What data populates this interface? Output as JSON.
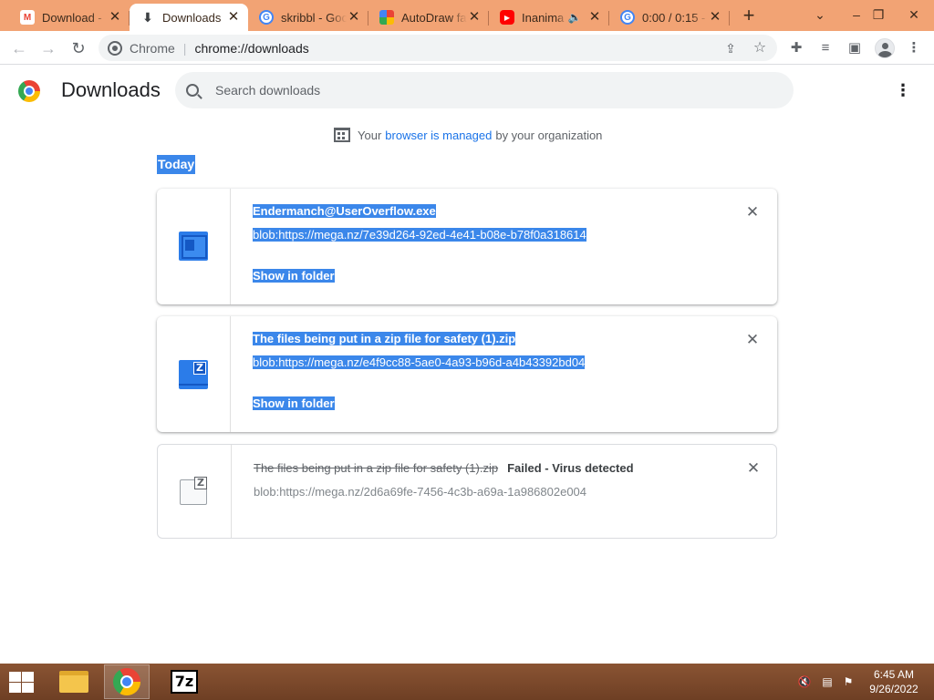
{
  "tabs": [
    {
      "title": "Download -",
      "favicon": "gmail-icon",
      "active": false
    },
    {
      "title": "Downloads",
      "favicon": "download-icon",
      "active": true
    },
    {
      "title": "skribbl - Goo",
      "favicon": "google-icon",
      "active": false
    },
    {
      "title": "AutoDraw fa",
      "favicon": "autodraw-icon",
      "active": false
    },
    {
      "title": "Inanima",
      "favicon": "youtube-icon",
      "active": false,
      "audio": true
    },
    {
      "title": "0:00 / 0:15 -",
      "favicon": "google-icon",
      "active": false
    }
  ],
  "omnibox": {
    "site_label": "Chrome",
    "url": "chrome://downloads"
  },
  "page": {
    "title": "Downloads",
    "search_placeholder": "Search downloads"
  },
  "managed_notice": {
    "prefix": "Your",
    "link": "browser is managed",
    "suffix": "by your organization"
  },
  "date_header": "Today",
  "downloads": [
    {
      "filename": "Endermanch@UserOverflow.exe",
      "url": "blob:https://mega.nz/7e39d264-92ed-4e41-b08e-b78f0a318614",
      "action": "Show in folder",
      "status": "",
      "icon": "exe-file-icon"
    },
    {
      "filename": "The files being put in a zip file for safety (1).zip",
      "url": "blob:https://mega.nz/e4f9cc88-5ae0-4a93-b96d-a4b43392bd04",
      "action": "Show in folder",
      "status": "",
      "icon": "zip-file-icon"
    },
    {
      "filename": "The files being put in a zip file for safety (1).zip",
      "url": "blob:https://mega.nz/2d6a69fe-7456-4c3b-a69a-1a986802e004",
      "action": "",
      "status": "Failed - Virus detected",
      "icon": "zip-file-icon"
    }
  ],
  "taskbar": {
    "time": "6:45 AM",
    "date": "9/26/2022",
    "apps": [
      "file-explorer-icon",
      "chrome-icon",
      "7zip-icon"
    ]
  },
  "colors": {
    "tabstrip": "#f2a374",
    "selection": "#3b87ea",
    "link": "#1a73e8"
  }
}
